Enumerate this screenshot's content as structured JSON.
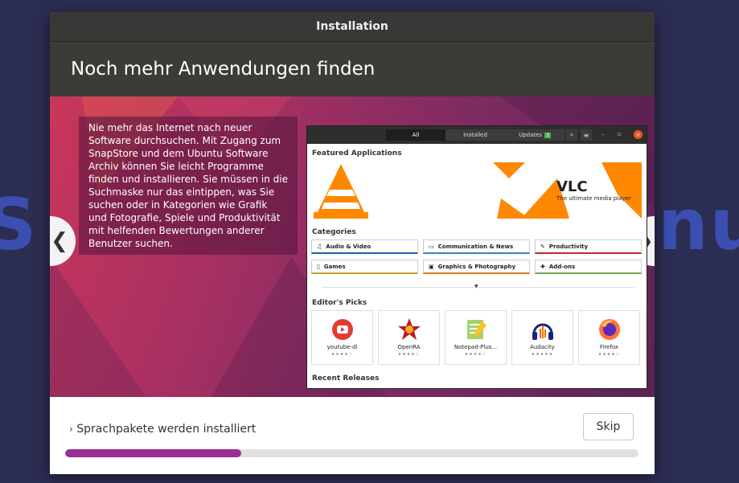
{
  "background": {
    "left_text": "S",
    "right_text": "nu"
  },
  "window": {
    "title": "Installation"
  },
  "header": {
    "title": "Noch mehr Anwendungen finden"
  },
  "slide": {
    "description": "Nie mehr das Internet nach neuer Software durchsuchen. Mit Zugang zum SnapStore und dem Ubuntu Software Archiv können Sie leicht Programme finden und installieren. Sie müssen in die Suchmaske nur das eintippen, was Sie suchen oder in Kategorien wie Grafik und Fotografie, Spiele und Produktivität mit helfenden Bewertungen anderer Benutzer suchen.",
    "prev_glyph": "❮",
    "next_glyph": "❯"
  },
  "store": {
    "tabs": [
      {
        "label": "All",
        "active": true
      },
      {
        "label": "Installed",
        "active": false
      },
      {
        "label": "Updates",
        "active": false,
        "badge": "3"
      }
    ],
    "featured_title": "Featured Applications",
    "banner": {
      "title": "VLC",
      "subtitle": "The ultimate media player"
    },
    "categories_title": "Categories",
    "categories": [
      {
        "label": "Audio & Video",
        "color": "#1e5fa8",
        "icon": "♫"
      },
      {
        "label": "Communication & News",
        "color": "#3a82c4",
        "icon": "▭"
      },
      {
        "label": "Productivity",
        "color": "#c62828",
        "icon": "✎"
      },
      {
        "label": "Games",
        "color": "#c9a227",
        "icon": "▯"
      },
      {
        "label": "Graphics & Photography",
        "color": "#e07b22",
        "icon": "▣"
      },
      {
        "label": "Add-ons",
        "color": "#6aa84f",
        "icon": "✚"
      }
    ],
    "picks_title": "Editor's Picks",
    "picks": [
      {
        "name": "youtube-dl",
        "stars": "★★★★☆"
      },
      {
        "name": "OpenRA",
        "stars": "★★★★☆"
      },
      {
        "name": "Notepad-Plus...",
        "stars": "★★★★☆"
      },
      {
        "name": "Audacity",
        "stars": "★★★★★"
      },
      {
        "name": "Firefox",
        "stars": "★★★★☆"
      }
    ],
    "recent_title": "Recent Releases"
  },
  "bottom": {
    "status": "Sprachpakete werden installiert",
    "skip_label": "Skip",
    "progress": 0.307,
    "progress_color": "#9a2e95"
  }
}
